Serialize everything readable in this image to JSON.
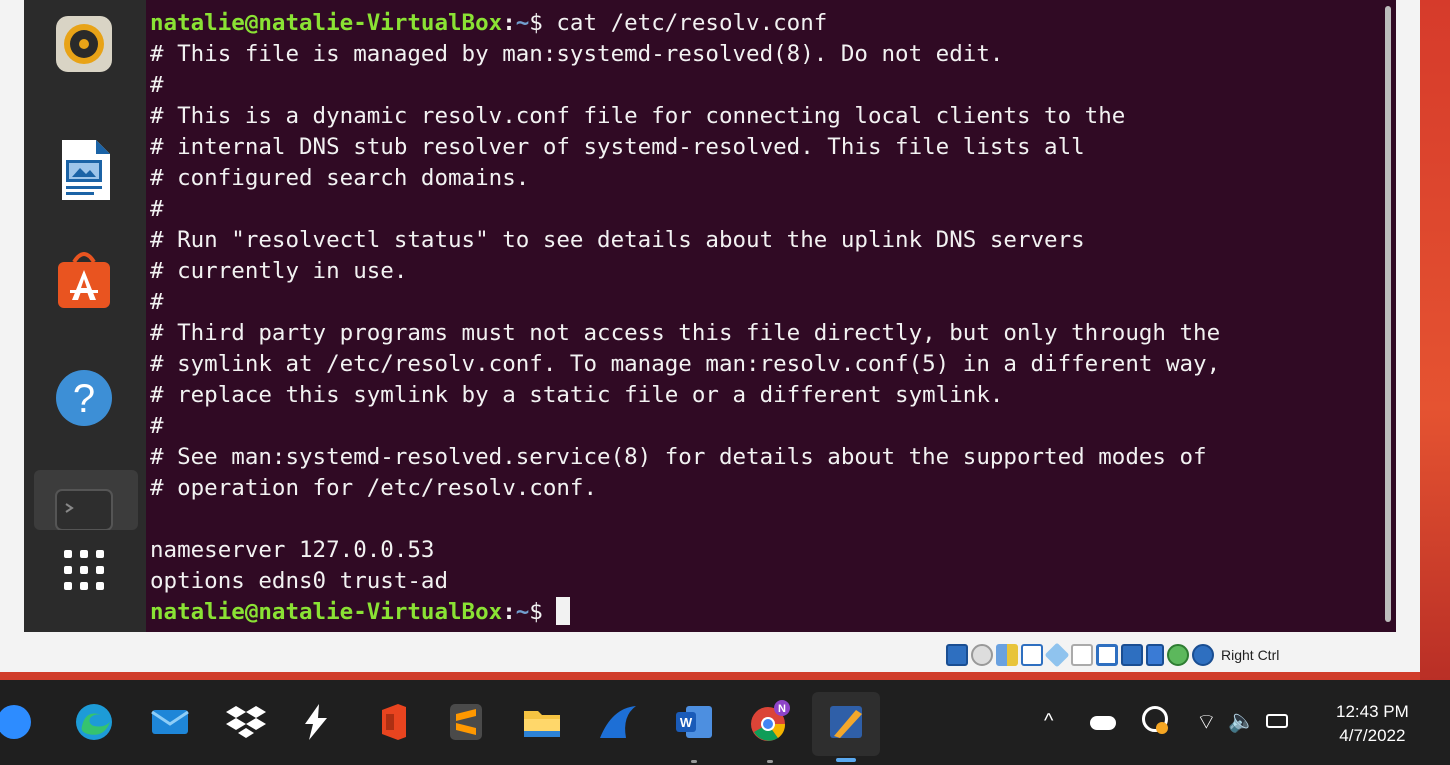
{
  "terminal": {
    "prompt_user": "natalie@natalie-VirtualBox",
    "prompt_path": "~",
    "prompt_symbol": "$",
    "command": " cat /etc/resolv.conf",
    "output_lines": [
      "# This file is managed by man:systemd-resolved(8). Do not edit.",
      "#",
      "# This is a dynamic resolv.conf file for connecting local clients to the",
      "# internal DNS stub resolver of systemd-resolved. This file lists all",
      "# configured search domains.",
      "#",
      "# Run \"resolvectl status\" to see details about the uplink DNS servers",
      "# currently in use.",
      "#",
      "# Third party programs must not access this file directly, but only through the",
      "# symlink at /etc/resolv.conf. To manage man:resolv.conf(5) in a different way,",
      "# replace this symlink by a static file or a different symlink.",
      "#",
      "# See man:systemd-resolved.service(8) for details about the supported modes of",
      "# operation for /etc/resolv.conf.",
      "",
      "nameserver 127.0.0.53",
      "options edns0 trust-ad"
    ]
  },
  "dock": {
    "icons": [
      "rhythmbox-icon",
      "libreoffice-impress-icon",
      "software-center-icon",
      "help-icon",
      "terminal-icon",
      "show-apps-icon"
    ]
  },
  "vbox_status": {
    "host_key_label": "Right Ctrl"
  },
  "taskbar": {
    "apps": [
      "zoom-icon",
      "edge-icon",
      "mail-icon",
      "dropbox-icon",
      "slash-app-icon",
      "office-icon",
      "sublime-icon",
      "file-explorer-icon",
      "wireshark-icon",
      "word-icon",
      "chrome-icon",
      "virtualbox-icon"
    ],
    "chrome_badge": "N",
    "time": "12:43 PM",
    "date": "4/7/2022"
  },
  "colors": {
    "terminal_bg": "#300a24",
    "prompt_user": "#8ae234",
    "prompt_path": "#729fcf"
  }
}
